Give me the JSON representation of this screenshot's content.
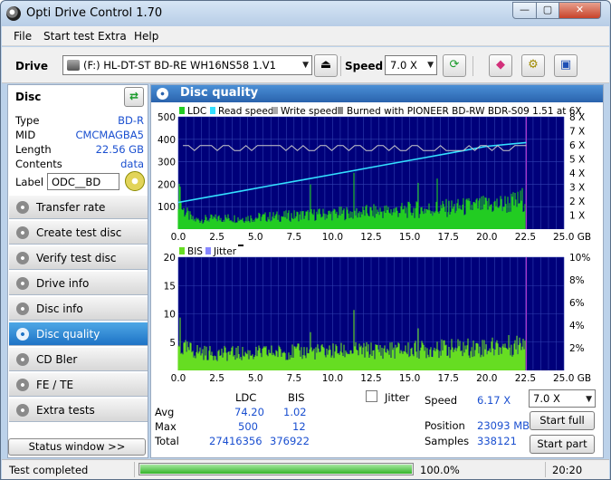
{
  "window": {
    "title": "Opti Drive Control 1.70",
    "min_glyph": "—",
    "max_glyph": "▢",
    "close_glyph": "✕"
  },
  "menu": [
    "File",
    "Start test",
    "Extra",
    "Help"
  ],
  "toolbar": {
    "drive_label": "Drive",
    "drive_value": "(F:)   HL-DT-ST BD-RE  WH16NS58 1.V1",
    "speed_label": "Speed",
    "speed_value": "7.0 X"
  },
  "disc": {
    "title": "Disc",
    "rows": [
      {
        "k": "Type",
        "v": "BD-R"
      },
      {
        "k": "MID",
        "v": "CMCMAGBA5"
      },
      {
        "k": "Length",
        "v": "22.56 GB"
      },
      {
        "k": "Contents",
        "v": "data"
      }
    ],
    "label_key": "Label",
    "label_value": "ODC__BD"
  },
  "nav": [
    "Transfer rate",
    "Create test disc",
    "Verify test disc",
    "Drive info",
    "Disc info",
    "Disc quality",
    "CD Bler",
    "FE / TE",
    "Extra tests"
  ],
  "nav_active": 5,
  "status_window_label": "Status window >>",
  "panel_title": "Disc quality",
  "legend_top": {
    "ldc": "LDC",
    "read": "Read speed",
    "write": "Write speed",
    "burned": "Burned with PIONEER BD-RW   BDR-S09 1.51 at 6X"
  },
  "legend_bottom": {
    "bis": "BIS",
    "jitter": "Jitter"
  },
  "colors": {
    "plot_bg": "#00007a",
    "grid": "#3040b0",
    "ldc": "#22cc22",
    "bis": "#66dd22",
    "read": "#33e0ff",
    "write": "#cccccc",
    "marker": "#aa33cc"
  },
  "chart_data": [
    {
      "type": "area",
      "series": [
        {
          "name": "LDC",
          "x": [
            0,
            0.3,
            1,
            2,
            3,
            4,
            5,
            6,
            7,
            8,
            9,
            10,
            11,
            12,
            13,
            14,
            15,
            16,
            17,
            18,
            19,
            20,
            21,
            22,
            22.56
          ],
          "y": [
            170,
            90,
            40,
            45,
            50,
            48,
            52,
            55,
            58,
            62,
            65,
            68,
            72,
            75,
            78,
            82,
            85,
            88,
            92,
            95,
            100,
            105,
            110,
            120,
            140
          ]
        },
        {
          "name": "Read speed",
          "x": [
            0,
            2,
            4,
            6,
            8,
            10,
            12,
            14,
            16,
            18,
            20,
            22.56
          ],
          "y": [
            1.9,
            2.3,
            2.7,
            3.1,
            3.5,
            3.9,
            4.3,
            4.7,
            5.1,
            5.5,
            5.9,
            6.17
          ]
        },
        {
          "name": "Write speed",
          "x": [
            0,
            1,
            22.56
          ],
          "y": [
            6.0,
            6.0,
            6.0
          ]
        }
      ],
      "xlim": [
        0,
        25
      ],
      "ylim": [
        0,
        500
      ],
      "y2lim": [
        0,
        8
      ],
      "xticks": [
        "0.0",
        "2.5",
        "5.0",
        "7.5",
        "10.0",
        "12.5",
        "15.0",
        "17.5",
        "20.0",
        "22.5",
        "25.0 GB"
      ],
      "yticks": [
        "100",
        "200",
        "300",
        "400",
        "500"
      ],
      "y2ticks": [
        "1 X",
        "2 X",
        "3 X",
        "4 X",
        "5 X",
        "6 X",
        "7 X",
        "8 X"
      ]
    },
    {
      "type": "area",
      "series": [
        {
          "name": "BIS",
          "x": [
            0,
            1,
            2,
            3,
            4,
            5,
            6,
            7,
            8,
            9,
            10,
            11,
            12,
            13,
            14,
            15,
            16,
            17,
            18,
            19,
            20,
            21,
            22,
            22.56
          ],
          "y": [
            4,
            3.5,
            3,
            3,
            3,
            3,
            3.2,
            3.2,
            3.3,
            3.3,
            3.4,
            3.4,
            3.5,
            3.5,
            3.6,
            3.6,
            3.7,
            3.8,
            3.9,
            4,
            4.1,
            4.2,
            4.5,
            6
          ]
        },
        {
          "name": "Jitter",
          "x": [],
          "y": []
        }
      ],
      "xlim": [
        0,
        25
      ],
      "ylim": [
        0,
        20
      ],
      "y2lim": [
        0,
        10
      ],
      "xticks": [
        "0.0",
        "2.5",
        "5.0",
        "7.5",
        "10.0",
        "12.5",
        "15.0",
        "17.5",
        "20.0",
        "22.5",
        "25.0 GB"
      ],
      "yticks": [
        "5",
        "10",
        "15",
        "20"
      ],
      "y2ticks": [
        "2%",
        "4%",
        "6%",
        "8%",
        "10%"
      ]
    }
  ],
  "stats": {
    "col_ldc": "LDC",
    "col_bis": "BIS",
    "avg_label": "Avg",
    "avg_ldc": "74.20",
    "avg_bis": "1.02",
    "max_label": "Max",
    "max_ldc": "500",
    "max_bis": "12",
    "total_label": "Total",
    "total_ldc": "27416356",
    "total_bis": "376922",
    "jitter_label": "Jitter",
    "speed_label": "Speed",
    "speed_value": "6.17 X",
    "position_label": "Position",
    "position_value": "23093 MB",
    "samples_label": "Samples",
    "samples_value": "338121",
    "speed_select": "7.0 X",
    "start_full": "Start full",
    "start_part": "Start part"
  },
  "status": {
    "text": "Test completed",
    "progress": 100.0,
    "progress_text": "100.0%",
    "clock": "20:20"
  }
}
